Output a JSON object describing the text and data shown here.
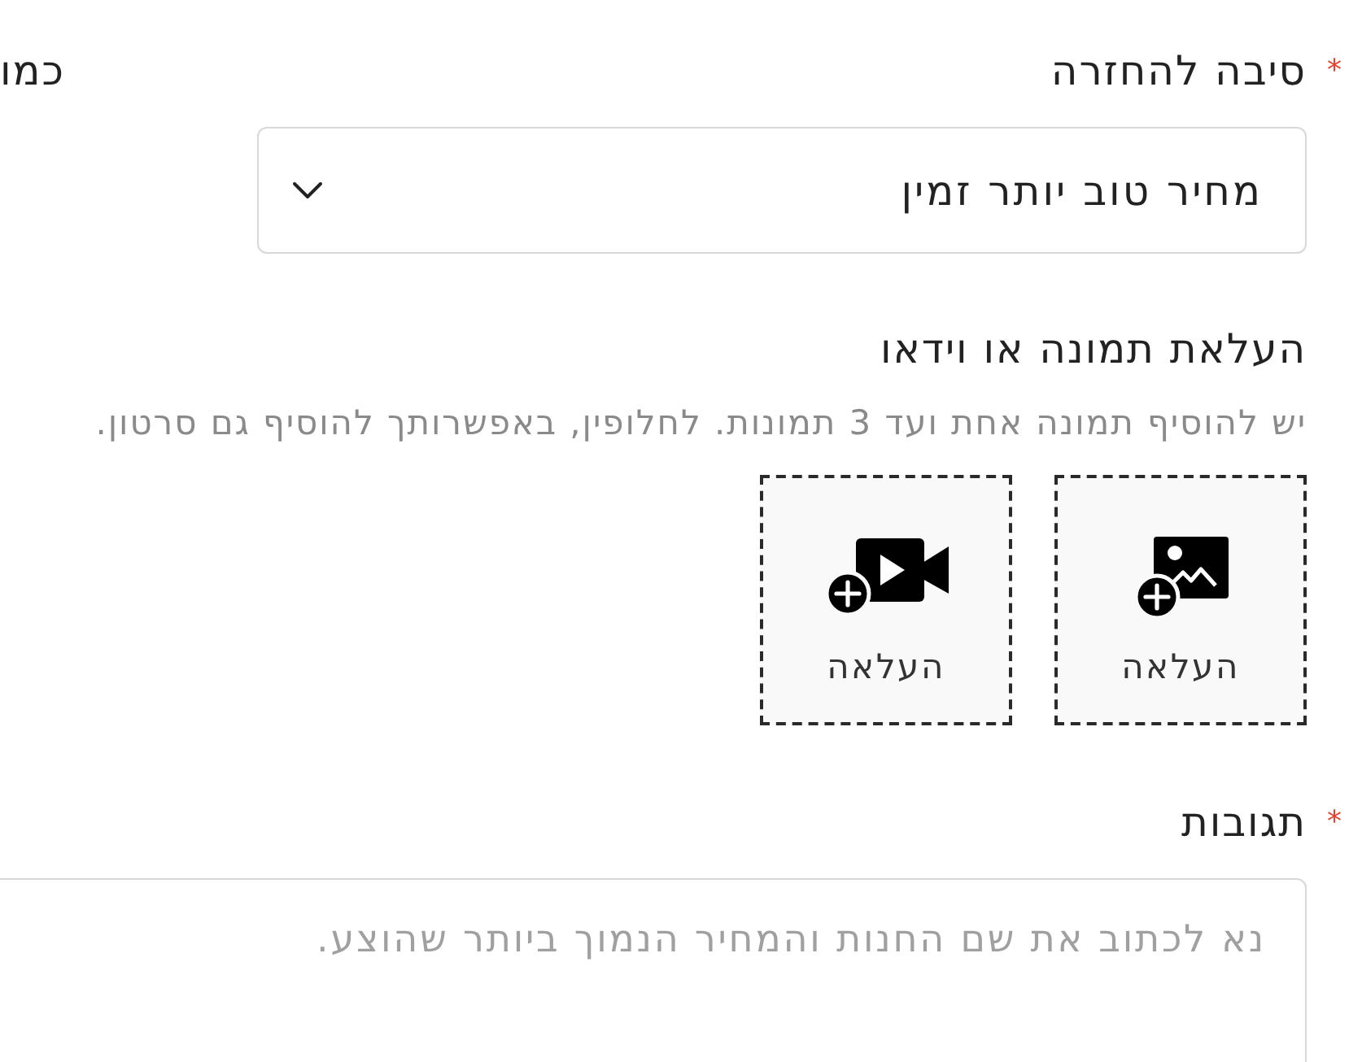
{
  "side_label": "כמו",
  "reason": {
    "label": "סיבה להחזרה",
    "required": true,
    "required_mark": "*",
    "value": "מחיר טוב יותר זמין"
  },
  "upload": {
    "title": "העלאת תמונה או וידאו",
    "hint": "יש להוסיף תמונה אחת ועד 3 תמונות. לחלופין, באפשרותך להוסיף גם סרטון.",
    "tiles": [
      {
        "kind": "image",
        "label": "העלאה"
      },
      {
        "kind": "video",
        "label": "העלאה"
      }
    ]
  },
  "comments": {
    "label": "תגובות",
    "required": true,
    "required_mark": "*",
    "placeholder": "נא לכתוב את שם החנות והמחיר הנמוך ביותר שהוצע."
  }
}
